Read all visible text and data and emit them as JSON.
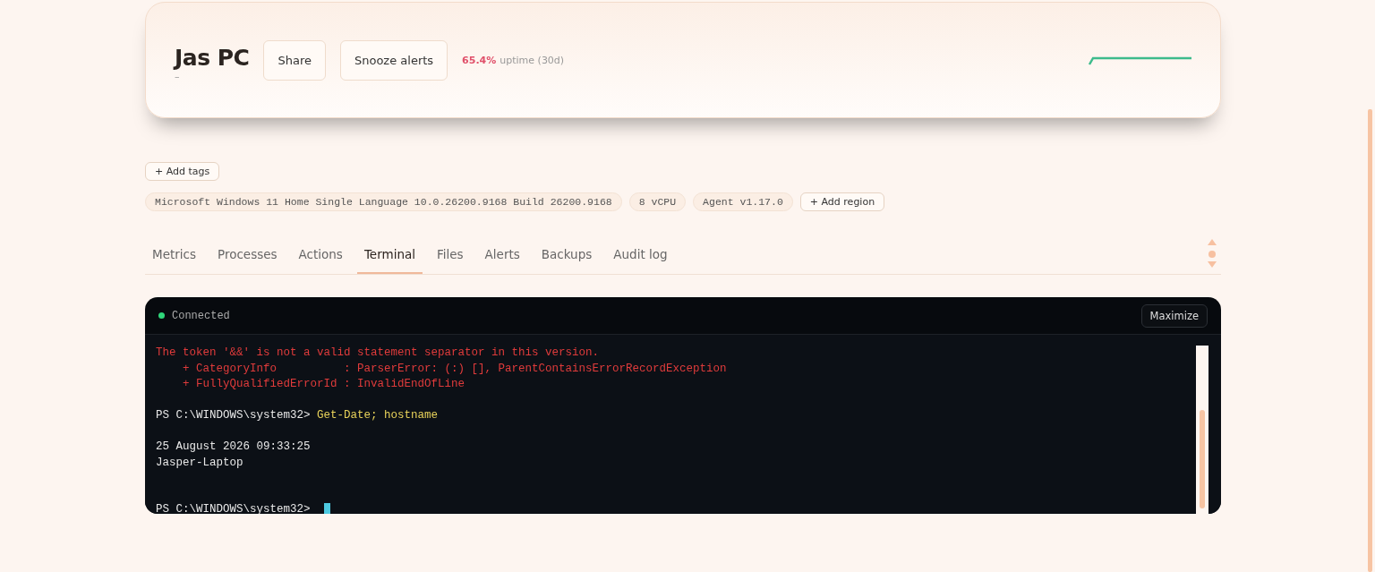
{
  "header": {
    "title": "Jas PC",
    "subtitle": "–",
    "buttons": [
      "Share",
      "Snooze alerts"
    ],
    "uptime_value": "65.4%",
    "uptime_label": "uptime (30d)"
  },
  "add_tags": "+ Add tags",
  "chips": [
    {
      "kind": "info",
      "label": "Microsoft Windows 11 Home Single Language 10.0.26200.9168 Build 26200.9168"
    },
    {
      "kind": "info",
      "label": "8 vCPU"
    },
    {
      "kind": "info",
      "label": "Agent v1.17.0"
    },
    {
      "kind": "action",
      "label": "+ Add region"
    }
  ],
  "tabs": [
    {
      "label": "Metrics",
      "selected": false
    },
    {
      "label": "Processes",
      "selected": false
    },
    {
      "label": "Actions",
      "selected": false
    },
    {
      "label": "Terminal",
      "selected": true
    },
    {
      "label": "Files",
      "selected": false
    },
    {
      "label": "Alerts",
      "selected": false
    },
    {
      "label": "Backups",
      "selected": false
    },
    {
      "label": "Audit log",
      "selected": false
    }
  ],
  "terminal": {
    "status": "Connected",
    "connected": true,
    "maximize": "Maximize",
    "lines": [
      {
        "kind": "error",
        "text": "The token '&&' is not a valid statement separator in this version."
      },
      {
        "kind": "error",
        "text": "    + CategoryInfo          : ParserError: (:) [], ParentContainsErrorRecordException"
      },
      {
        "kind": "error",
        "text": "    + FullyQualifiedErrorId : InvalidEndOfLine"
      },
      {
        "kind": "blank"
      },
      {
        "kind": "prompt",
        "prompt": "PS C:\\WINDOWS\\system32>",
        "command": "Get-Date; hostname"
      },
      {
        "kind": "blank"
      },
      {
        "kind": "output",
        "text": "25 August 2026 09:33:25"
      },
      {
        "kind": "output",
        "text": "Jasper-Laptop"
      },
      {
        "kind": "blank"
      },
      {
        "kind": "blank"
      },
      {
        "kind": "prompt",
        "prompt": "PS C:\\WINDOWS\\system32>",
        "cursor": true
      }
    ]
  }
}
